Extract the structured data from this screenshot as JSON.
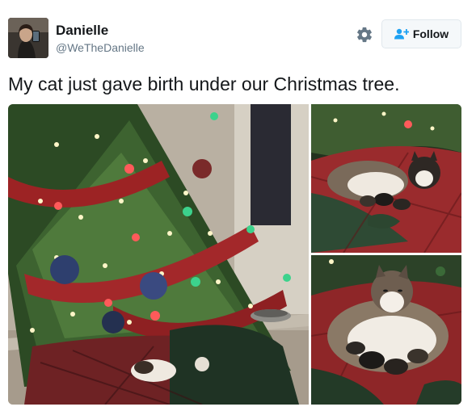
{
  "user": {
    "display_name": "Danielle",
    "handle": "@WeTheDanielle",
    "avatar_icon": "profile-photo"
  },
  "actions": {
    "settings_icon": "gear-icon",
    "follow_label": "Follow",
    "follow_icon": "add-person-icon",
    "follow_color": "#1da1f2"
  },
  "tweet": {
    "text": "My cat just gave birth under our Christmas tree."
  },
  "media": {
    "photos": [
      {
        "name": "christmas-tree-photo"
      },
      {
        "name": "cat-with-kittens-photo"
      },
      {
        "name": "cat-nursing-kittens-closeup-photo"
      }
    ]
  }
}
